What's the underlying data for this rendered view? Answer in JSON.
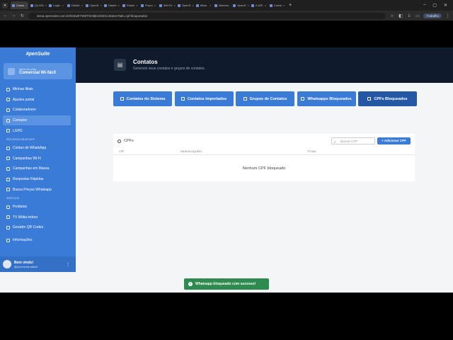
{
  "browser": {
    "tabs": [
      {
        "label": "Conta"
      },
      {
        "label": "(3) WG"
      },
      {
        "label": "Login"
      },
      {
        "label": "Detalh"
      },
      {
        "label": "OpenS"
      },
      {
        "label": "Dashb"
      },
      {
        "label": "Painel"
      },
      {
        "label": "Propo"
      },
      {
        "label": "360 Fe"
      },
      {
        "label": "OpenS"
      },
      {
        "label": "Meta"
      },
      {
        "label": "Número"
      },
      {
        "label": "OpenS"
      },
      {
        "label": "Z-API"
      },
      {
        "label": "Conta"
      }
    ],
    "url": "wssa.opensuite.com.br/ID2wEYWZTSOtjEcIDIZ/contatos?tab=cpf-bloqueados",
    "profile_label": "Trabalho"
  },
  "sidebar": {
    "logo": "#penSuite",
    "company_caption": "Nome da conta",
    "company_name": "Comercial Wi-fácil",
    "items": [
      {
        "label": "Minhas filiais"
      },
      {
        "label": "Ajustes portal"
      },
      {
        "label": "Colaboradores"
      },
      {
        "label": "Contatos"
      },
      {
        "label": "LGPD"
      }
    ],
    "section_whatsapp": "RECURSOS WHATSAPP",
    "whatsapp_items": [
      {
        "label": "Contas de WhatsApp"
      },
      {
        "label": "Campanhas Wi-Fi"
      },
      {
        "label": "Campanhas em Massa"
      },
      {
        "label": "Respostas Rápidas"
      },
      {
        "label": "Busca Preços Whatsapp"
      }
    ],
    "section_services": "SERVIÇOS",
    "service_items": [
      {
        "label": "Produtos"
      },
      {
        "label": "TV Mídia indoor"
      },
      {
        "label": "Gerador QR Codes"
      }
    ],
    "info_label": "Informações",
    "user_greeting": "Bem vindo!",
    "user_handle": "@comercial.wifacil"
  },
  "header": {
    "title": "Contatos",
    "subtitle": "Gerencie seus contatos e grupos de contatos."
  },
  "tabs": [
    {
      "label": "Contatos do Sistema"
    },
    {
      "label": "Contatos importados"
    },
    {
      "label": "Grupos de Contatos"
    },
    {
      "label": "Whatsapps Bloqueados"
    },
    {
      "label": "CPFs Bloqueados"
    }
  ],
  "card": {
    "title": "CPFs",
    "search_placeholder": "Buscar CPF",
    "add_label": "+ Adicionar CPF",
    "columns": [
      "CPF",
      "DATA BLOQUEIO",
      "TITUAL"
    ],
    "empty_message": "Nenhum CPF bloqueado"
  },
  "toast": {
    "message": "Whatsapp bloqueado com sucesso!"
  }
}
